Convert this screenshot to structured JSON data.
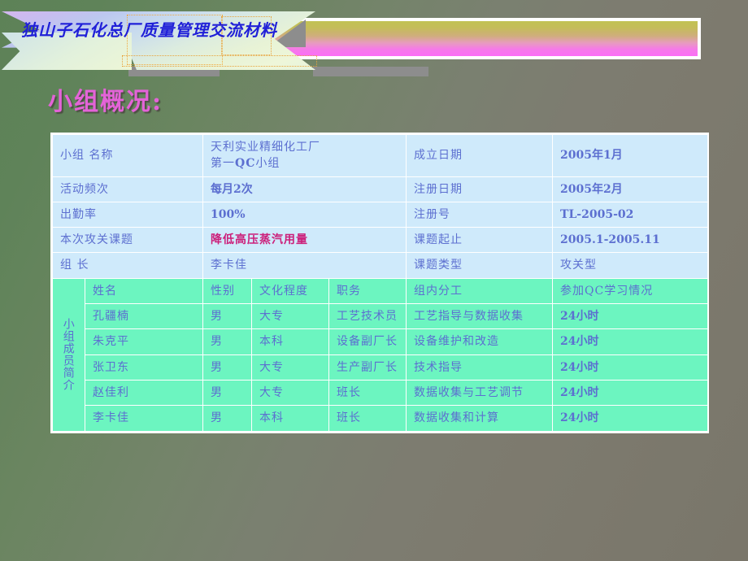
{
  "banner": {
    "title": "独山子石化总厂质量管理交流材料"
  },
  "heading": "小组概况:",
  "info_table": {
    "rows": [
      {
        "label": "小组 名称",
        "value": "天利实业精细化工厂\n第一QC小组",
        "label2": "成立日期",
        "value2": "2005年1月",
        "value_style": "normal",
        "tall": true
      },
      {
        "label": "活动频次",
        "value": "每月2次",
        "label2": "注册日期",
        "value2": "2005年2月"
      },
      {
        "label": "出勤率",
        "value": "100%",
        "label2": "注册号",
        "value2": "TL-2005-02"
      },
      {
        "label": "本次攻关课题",
        "value": "降低高压蒸汽用量",
        "label2": "课题起止",
        "value2": "2005.1-2005.11",
        "value_style": "topic"
      },
      {
        "label": "组 长",
        "value": "李卡佳",
        "label2": "课题类型",
        "value2": "攻关型",
        "value_style": "normal"
      }
    ]
  },
  "members_table": {
    "side_label": "小组成员简介",
    "headers": [
      "姓名",
      "性别",
      "文化程度",
      "职务",
      "组内分工",
      "参加QC学习情况"
    ],
    "rows": [
      [
        "孔疆楠",
        "男",
        "大专",
        "工艺技术员",
        "工艺指导与数据收集",
        "24小时"
      ],
      [
        "朱克平",
        "男",
        "本科",
        "设备副厂长",
        "设备维护和改造",
        "24小时"
      ],
      [
        "张卫东",
        "男",
        "大专",
        "生产副厂长",
        "技术指导",
        "24小时"
      ],
      [
        "赵佳利",
        "男",
        "大专",
        "班长",
        "数据收集与工艺调节",
        "24小时"
      ],
      [
        "李卡佳",
        "男",
        "本科",
        "班长",
        "数据收集和计算",
        "24小时"
      ]
    ]
  },
  "colors": {
    "banner_text": "#2020d8",
    "heading": "#e463d8",
    "table_text": "#5c6fd0",
    "topic_text": "#cc1f7a",
    "blue_cell": "#cfeafb",
    "green_cell": "#6cf5c0",
    "background_left": "#5d8257",
    "background_right": "#7a766a"
  }
}
